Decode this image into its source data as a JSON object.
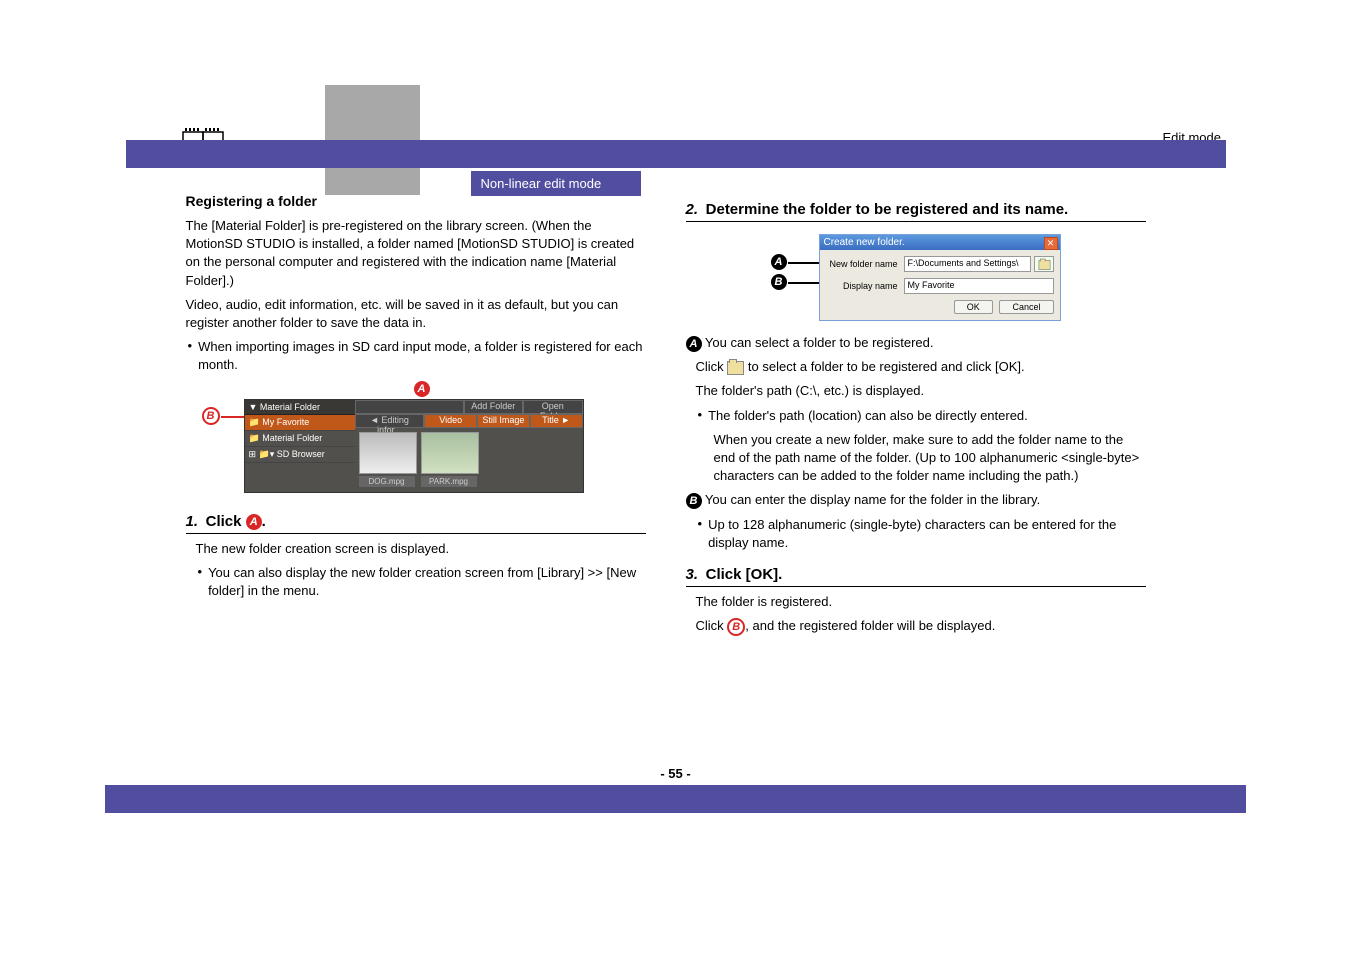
{
  "header": {
    "edit_mode": "Edit mode",
    "section_title": "Non-linear edit mode"
  },
  "left": {
    "subhead": "Registering a folder",
    "intro1": "The [Material Folder] is pre-registered on the library screen. (When the MotionSD STUDIO is installed, a folder named [MotionSD STUDIO] is created on the personal computer and registered with the indication name [Material Folder].)",
    "intro2": "Video, audio, edit information, etc. will be saved in it as default, but you can register another folder to save the data in.",
    "bullet1": "When importing images in SD card input mode, a folder is registered for each month.",
    "shot1": {
      "side_head": "Material Folder",
      "side_item1": "My Favorite",
      "side_item2": "Material Folder",
      "side_item3": "SD Browser",
      "tab_add": "Add Folder",
      "tab_open": "Open Folder",
      "tab_editing": "◄ Editing infor...",
      "tab_video": "Video",
      "tab_still": "Still Image",
      "tab_title": "Title ►",
      "thumb1": "DOG.mpg",
      "thumb2": "PARK.mpg"
    },
    "step1_num": "1.",
    "step1_text_a": "Click ",
    "step1_text_b": ".",
    "step1_desc": "The new folder creation screen is displayed.",
    "step1_bullet": "You can also display the new folder creation screen from [Library] >> [New folder] in the menu."
  },
  "right": {
    "step2_num": "2.",
    "step2_text": "Determine the folder to be registered and its name.",
    "dialog": {
      "title": "Create new folder.",
      "label_newfolder": "New folder name",
      "input_newfolder": "F:\\Documents and Settings\\",
      "label_display": "Display name",
      "input_display": "My Favorite",
      "btn_ok": "OK",
      "btn_cancel": "Cancel"
    },
    "desc_a_head": "You can select a folder to be registered.",
    "desc_a_1a": "Click ",
    "desc_a_1b": " to select a folder to be registered and click [OK].",
    "desc_a_2": "The folder's path (C:\\, etc.) is displayed.",
    "desc_a_bullet": "The folder's path (location) can also be directly entered.",
    "desc_a_3": "When you create a new folder, make sure to add the folder name to the end of the path name of the folder. (Up to 100 alphanumeric <single-byte> characters can be added to the folder name including the path.)",
    "desc_b_head": "You can enter the display name for the folder in the library.",
    "desc_b_bullet": "Up to 128 alphanumeric (single-byte) characters can be entered for the display name.",
    "step3_num": "3.",
    "step3_text": "Click [OK].",
    "step3_desc": "The folder is registered.",
    "step3_desc2a": "Click ",
    "step3_desc2b": ", and the registered folder will be displayed."
  },
  "page_number": "- 55 -"
}
